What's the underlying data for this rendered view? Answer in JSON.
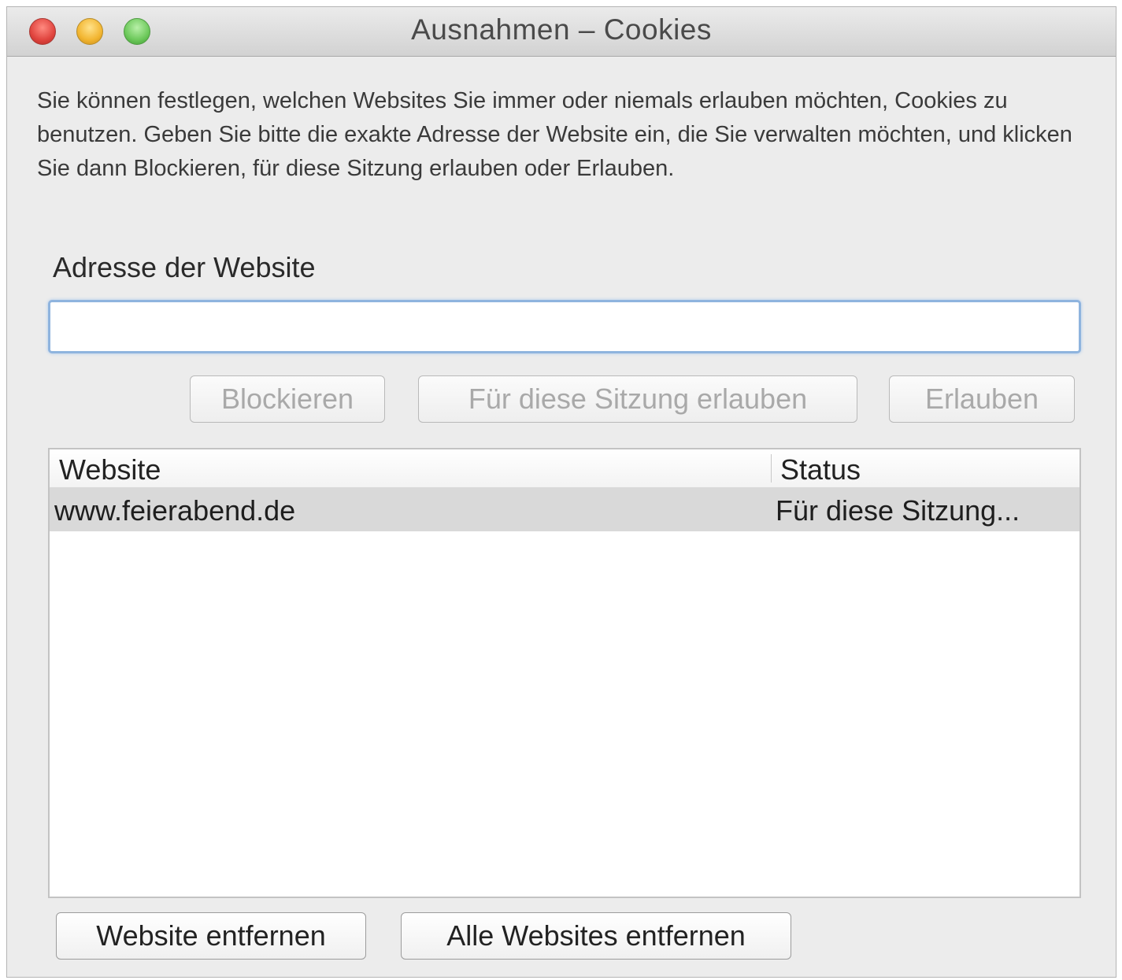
{
  "window": {
    "title": "Ausnahmen – Cookies"
  },
  "description": "Sie können festlegen, welchen Websites Sie immer oder niemals erlauben möchten, Cookies zu benutzen. Geben Sie bitte die exakte Adresse der Website ein, die Sie verwalten möchten, und klicken Sie dann Blockieren, für diese Sitzung erlauben oder Erlauben.",
  "address": {
    "label": "Adresse der Website",
    "value": "",
    "placeholder": ""
  },
  "actions": {
    "block": "Blockieren",
    "allow_session": "Für diese Sitzung erlauben",
    "allow": "Erlauben"
  },
  "table": {
    "columns": [
      "Website",
      "Status"
    ],
    "rows": [
      {
        "website": "www.feierabend.de",
        "status": "Für diese Sitzung..."
      }
    ]
  },
  "footer": {
    "remove_site": "Website entfernen",
    "remove_all": "Alle Websites entfernen"
  },
  "colors": {
    "close": "#e0443e",
    "minimize": "#f2b530",
    "maximize": "#6cc85a",
    "focus_ring": "#8fb4de",
    "selected_row": "#d9d9d9"
  }
}
